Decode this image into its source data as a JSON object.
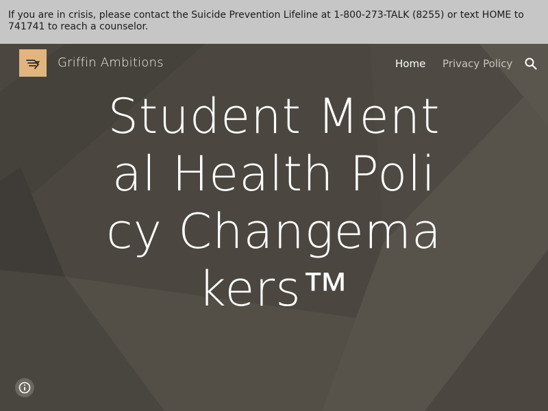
{
  "crisis_banner": {
    "text": "If you are in crisis, please contact the Suicide Prevention Lifeline at 1-800-273-TALK (8255) or text HOME to 741741 to reach a counselor."
  },
  "header": {
    "site_title": "Griffin Ambitions",
    "logo_color": "#e2b57f",
    "nav": {
      "home": "Home",
      "privacy": "Privacy Policy"
    },
    "search_icon": "search-icon"
  },
  "hero": {
    "headline": "Student Mental Health Policy Changemakers™",
    "background_color": "#4b4740"
  },
  "footer_controls": {
    "info_icon": "info-icon"
  }
}
